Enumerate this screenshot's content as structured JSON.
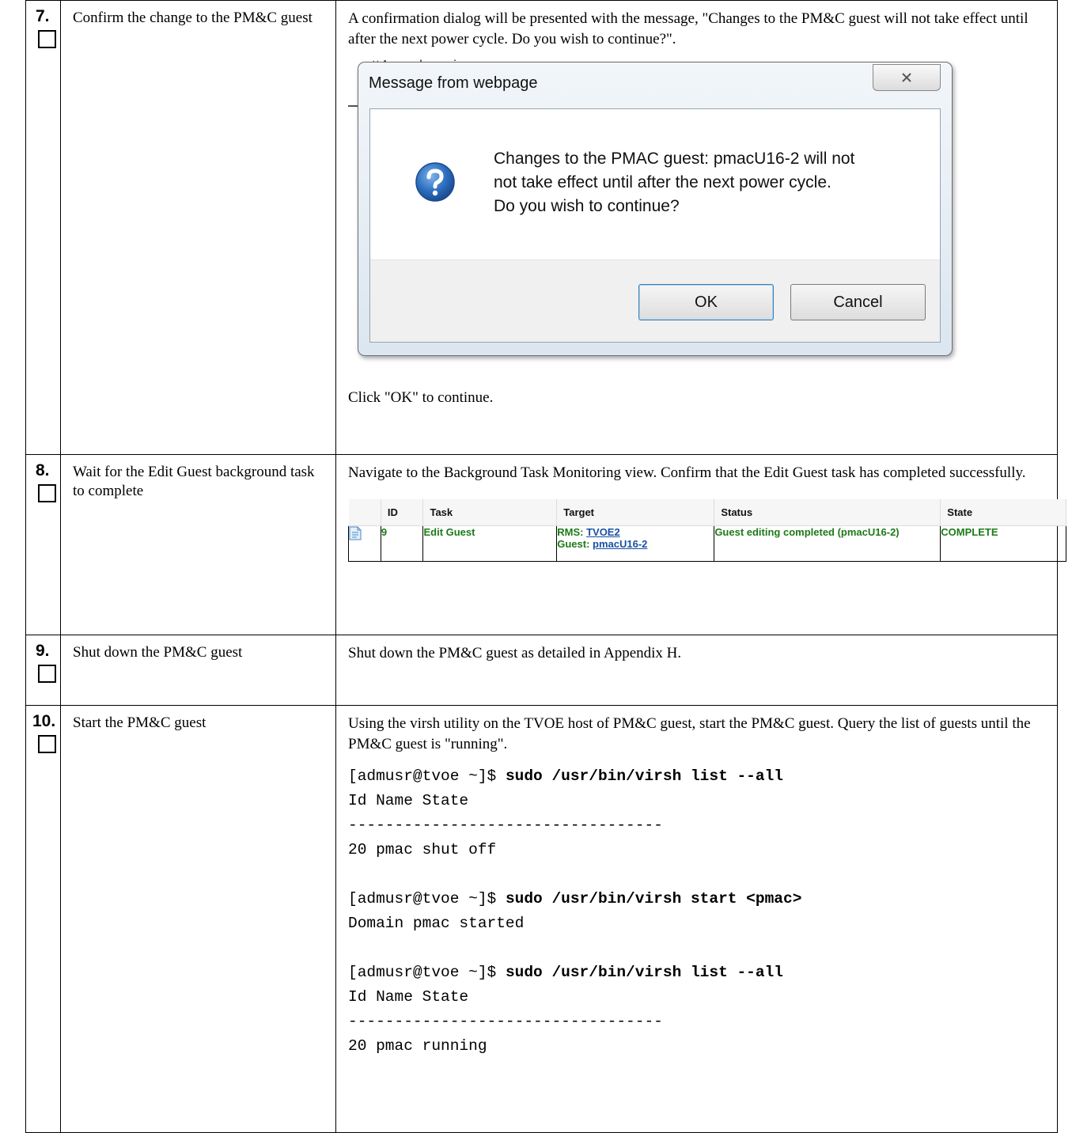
{
  "steps": [
    {
      "number": "7.",
      "title": "Confirm the change to the PM&C guest",
      "intro": "A confirmation dialog will be presented with the message, \"Changes to the PM&C guest will not take effect until after the next power cycle. Do you wish to continue?\".",
      "dialog": {
        "background_text": "ntt4au                    vdouesis",
        "title": "Message from webpage",
        "message_lines": [
          "Changes to the PMAC guest: pmacU16-2 will not",
          "not take effect until after the next power cycle.",
          "Do you wish to continue?"
        ],
        "ok_label": "OK",
        "cancel_label": "Cancel"
      },
      "outro": "Click \"OK\" to continue."
    },
    {
      "number": "8.",
      "title": "Wait for the Edit Guest background task to complete",
      "intro": "Navigate to the Background Task Monitoring view. Confirm that the Edit Guest task has completed successfully.",
      "task_table": {
        "headers": [
          "ID",
          "Task",
          "Target",
          "Status",
          "State"
        ],
        "row": {
          "id": "9",
          "task": "Edit Guest",
          "target_rms_label": "RMS:",
          "target_rms_value": "TVOE2",
          "target_guest_label": "Guest:",
          "target_guest_value": "pmacU16-2",
          "status": "Guest editing completed (pmacU16-2)",
          "state": "COMPLETE"
        }
      }
    },
    {
      "number": "9.",
      "title": "Shut down the PM&C guest",
      "intro": "Shut down the PM&C guest as detailed in Appendix H."
    },
    {
      "number": "10.",
      "title": "Start the PM&C guest",
      "intro": "Using the virsh utility on the TVOE host of PM&C guest, start the PM&C guest. Query the list of guests until the PM&C guest is \"running\".",
      "code": {
        "prompt": "[admusr@tvoe ~]$ ",
        "cmd_list": "sudo /usr/bin/virsh list --all",
        "cmd_start": "sudo /usr/bin/virsh start <pmac>",
        "header": "Id Name State",
        "separator": "----------------------------------",
        "row_off": "20 pmac shut off",
        "started": "Domain pmac started",
        "row_running": "20 pmac running"
      }
    }
  ],
  "colors": {
    "status_green": "#1c7b17",
    "link_blue": "#1a4fa5",
    "dialog_icon_blue": "#2e6fc0"
  }
}
